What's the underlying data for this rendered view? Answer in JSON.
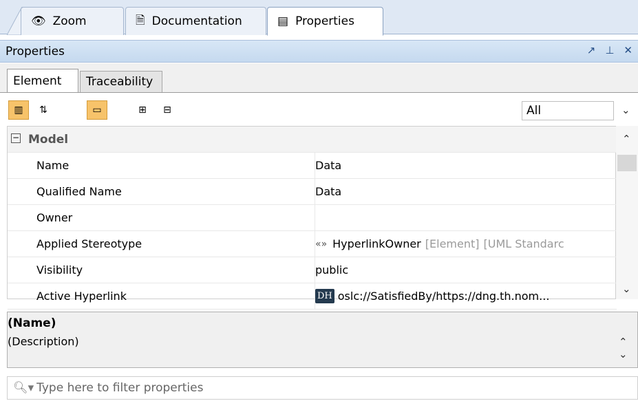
{
  "tabs": [
    {
      "label": "Zoom",
      "icon": "eye-icon",
      "active": false
    },
    {
      "label": "Documentation",
      "icon": "document-icon",
      "active": false
    },
    {
      "label": "Properties",
      "icon": "table-icon",
      "active": true
    }
  ],
  "panel": {
    "title": "Properties",
    "controls": [
      "restore-icon",
      "pin-icon",
      "close-icon"
    ]
  },
  "subtabs": [
    {
      "label": "Element",
      "active": true
    },
    {
      "label": "Traceability",
      "active": false
    }
  ],
  "toolbar": {
    "filter_value": "All",
    "buttons": [
      "group-by-category-icon",
      "sort-alphabetically-icon",
      "show-expert-icon",
      "expand-all-icon",
      "collapse-all-icon"
    ]
  },
  "grid": {
    "category": "Model",
    "rows": [
      {
        "key": "Name",
        "value": "Data"
      },
      {
        "key": "Qualified Name",
        "value": "Data"
      },
      {
        "key": "Owner",
        "value": ""
      },
      {
        "key": "Applied Stereotype",
        "value": "HyperlinkOwner",
        "extra1": "[Element]",
        "extra2": "[UML Standarc"
      },
      {
        "key": "Visibility",
        "value": "public"
      },
      {
        "key": "Active Hyperlink",
        "value": "oslc://SatisfiedBy/https://dng.th.nom...",
        "badge": "DH"
      }
    ]
  },
  "description": {
    "name": "(Name)",
    "text": "(Description)"
  },
  "search": {
    "placeholder": "Type here to filter properties"
  }
}
